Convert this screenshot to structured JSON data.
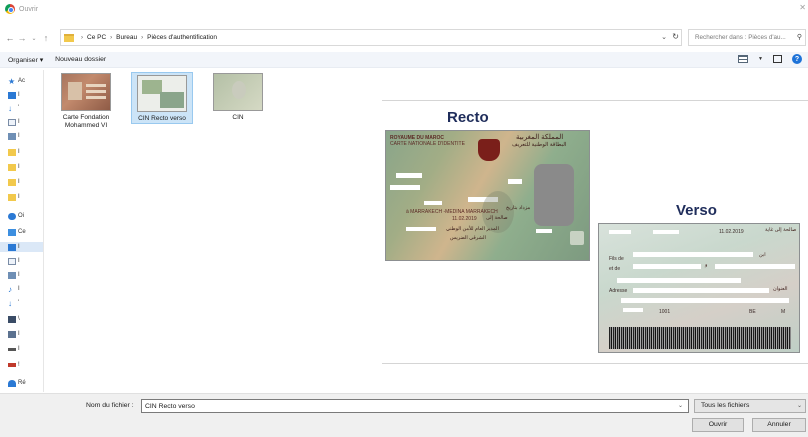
{
  "window": {
    "title": "Ouvrir"
  },
  "address": {
    "crumbs": [
      "Ce PC",
      "Bureau",
      "Pièces d'authentification"
    ],
    "search_placeholder": "Rechercher dans : Pièces d'au..."
  },
  "toolbar": {
    "organize": "Organiser ▾",
    "new_folder": "Nouveau dossier"
  },
  "nav": {
    "items": [
      {
        "label": "Ac",
        "icon": "star-icon"
      },
      {
        "label": "I",
        "icon": "desktop-icon"
      },
      {
        "label": "'",
        "icon": "download-icon"
      },
      {
        "label": "I",
        "icon": "document-icon"
      },
      {
        "label": "I",
        "icon": "picture-icon"
      },
      {
        "label": "I",
        "icon": "folder-icon"
      },
      {
        "label": "I",
        "icon": "folder-icon"
      },
      {
        "label": "I",
        "icon": "folder-icon"
      },
      {
        "label": "I",
        "icon": "folder-icon"
      },
      {
        "label": "Oi",
        "icon": "cloud-icon"
      },
      {
        "label": "Ce",
        "icon": "computer-icon"
      },
      {
        "label": "I",
        "icon": "desktop-icon"
      },
      {
        "label": "I",
        "icon": "document-icon"
      },
      {
        "label": "I",
        "icon": "picture-icon"
      },
      {
        "label": "I",
        "icon": "music-icon"
      },
      {
        "label": "'",
        "icon": "download-icon"
      },
      {
        "label": "\\",
        "icon": "video-icon"
      },
      {
        "label": "I",
        "icon": "drive-icon"
      },
      {
        "label": "I",
        "icon": "drive-icon"
      },
      {
        "label": "!",
        "icon": "network-drive-icon"
      },
      {
        "label": "Ré",
        "icon": "network-icon"
      }
    ]
  },
  "files": [
    {
      "name": "Carte Fondation Mohammed VI",
      "line1": "Carte Fondation",
      "line2": "Mohammed VI"
    },
    {
      "name": "CIN Recto verso"
    },
    {
      "name": "CIN"
    }
  ],
  "preview": {
    "recto_title": "Recto",
    "verso_title": "Verso",
    "recto": {
      "kingdom": "ROYAUME DU MAROC",
      "card_type": "CARTE NATIONALE D'IDENTITE",
      "ar_kingdom": "المملكة المغربية",
      "ar_card": "البطاقة الوطنية للتعريف",
      "birth_place": "à MARRAKECH -MEDINA MARRAKECH",
      "validity": "11.02.2019",
      "ar_valid": "صالحة إلى",
      "ar_born": "مزداد بتاريخ",
      "ar_sig1": "المدير العام للأمن الوطني",
      "ar_sig2": "الشرقي الضريس"
    },
    "verso": {
      "father": "Fils de",
      "mother": "et de",
      "address": "Adresse",
      "date": "11.02.2019",
      "ar_validity": "صالحة إلى غاية",
      "ar_father": "ابن",
      "ar_mother": "و",
      "ar_address": "العنوان",
      "sex_value": "M",
      "code": "BE",
      "num": "1001"
    }
  },
  "bottom": {
    "filename_label": "Nom du fichier :",
    "filename_value": "CIN Recto verso",
    "filter": "Tous les fichiers",
    "open": "Ouvrir",
    "cancel": "Annuler"
  }
}
